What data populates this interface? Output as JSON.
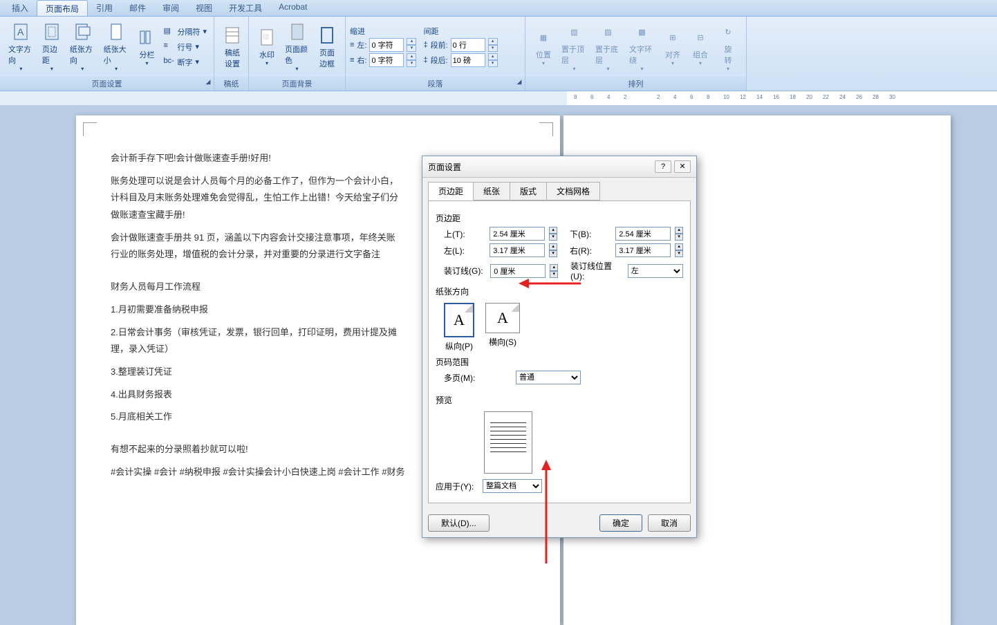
{
  "tabs": {
    "t0": "插入",
    "t1": "页面布局",
    "t2": "引用",
    "t3": "邮件",
    "t4": "审阅",
    "t5": "视图",
    "t6": "开发工具",
    "t7": "Acrobat"
  },
  "ribbon": {
    "pageSetup": {
      "label": "页面设置",
      "textDir": "文字方向",
      "margins": "页边距",
      "orient": "纸张方向",
      "size": "纸张大小",
      "columns": "分栏",
      "breaks": "分隔符",
      "lineNum": "行号",
      "hyphen": "断字"
    },
    "manuscript": {
      "label": "稿纸",
      "btn": "稿纸\n设置"
    },
    "pageBg": {
      "label": "页面背景",
      "watermark": "水印",
      "pageColor": "页面颜色",
      "border": "页面\n边框"
    },
    "paragraph": {
      "label": "段落",
      "indent": "缩进",
      "spacing": "间距",
      "leftLbl": "左:",
      "leftVal": "0 字符",
      "rightLbl": "右:",
      "rightVal": "0 字符",
      "beforeLbl": "段前:",
      "beforeVal": "0 行",
      "afterLbl": "段后:",
      "afterVal": "10 磅"
    },
    "arrange": {
      "label": "排列",
      "position": "位置",
      "front": "置于顶层",
      "back": "置于底层",
      "wrap": "文字环绕",
      "align": "对齐",
      "group": "组合",
      "rotate": "旋\n转"
    }
  },
  "doc": {
    "p1": "会计新手存下吧!会计做账速查手册!好用!",
    "p2": "账务处理可以说是会计人员每个月的必备工作了，但作为一个会计小白，",
    "p3": "计科目及月末账务处理难免会觉得乱，生怕工作上出错！今天给宝子们分",
    "p4": "做账速查宝藏手册!",
    "p5": "会计做账速查手册共 91 页，涵盖以下内容会计交接注意事项，年终关账",
    "p6": "行业的账务处理，增值税的会计分录，并对重要的分录进行文字备注",
    "p7": "财务人员每月工作流程",
    "p8": "1.月初需要准备纳税申报",
    "p9": "2.日常会计事务（审核凭证，发票，银行回单，打印证明，费用计提及摊",
    "p10": "理，录入凭证）",
    "p11": "3.整理装订凭证",
    "p12": "4.出具财务报表",
    "p13": "5.月底相关工作",
    "p14": "有想不起来的分录照着抄就可以啦!",
    "p15": "#会计实操 #会计 #纳税申报 #会计实操会计小白快速上岗 #会计工作 #财务"
  },
  "dialog": {
    "title": "页面设置",
    "tabs": {
      "margins": "页边距",
      "paper": "纸张",
      "layout": "版式",
      "grid": "文档网格"
    },
    "marginsSection": "页边距",
    "top": "上(T):",
    "topVal": "2.54 厘米",
    "bottom": "下(B):",
    "bottomVal": "2.54 厘米",
    "left": "左(L):",
    "leftVal": "3.17 厘米",
    "right": "右(R):",
    "rightVal": "3.17 厘米",
    "gutter": "装订线(G):",
    "gutterVal": "0 厘米",
    "gutterPos": "装订线位置(U):",
    "gutterPosVal": "左",
    "orientSection": "纸张方向",
    "portrait": "纵向(P)",
    "landscape": "横向(S)",
    "rangeSection": "页码范围",
    "multi": "多页(M):",
    "multiVal": "普通",
    "previewSection": "预览",
    "applyTo": "应用于(Y):",
    "applyToVal": "整篇文档",
    "defaultBtn": "默认(D)...",
    "ok": "确定",
    "cancel": "取消",
    "help": "?",
    "close": "✕"
  },
  "ruler": {
    "marks": [
      "8",
      "6",
      "4",
      "2",
      "",
      "2",
      "4",
      "6",
      "8",
      "10",
      "12",
      "14",
      "16",
      "18",
      "20",
      "22",
      "24",
      "26",
      "28",
      "30"
    ]
  }
}
